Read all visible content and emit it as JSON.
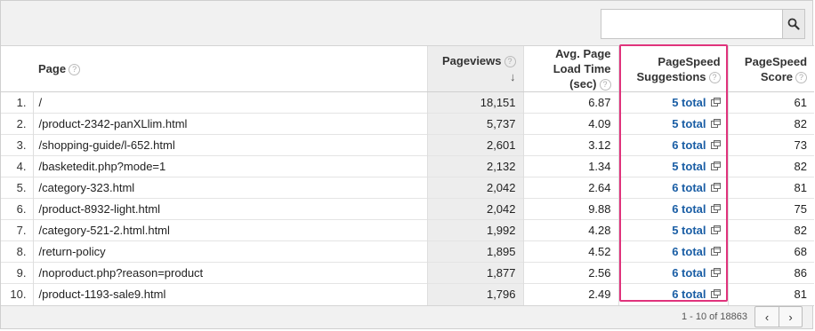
{
  "search": {
    "value": "",
    "placeholder": ""
  },
  "columns": {
    "page": "Page",
    "pageviews": "Pageviews",
    "load_time": "Avg. Page Load Time (sec)",
    "suggestions": "PageSpeed Suggestions",
    "score": "PageSpeed Score"
  },
  "rows": [
    {
      "idx": "1.",
      "page": "/",
      "pageviews": "18,151",
      "load": "6.87",
      "suggestions": "5 total",
      "score": "61"
    },
    {
      "idx": "2.",
      "page": "/product-2342-panXLlim.html",
      "pageviews": "5,737",
      "load": "4.09",
      "suggestions": "5 total",
      "score": "82"
    },
    {
      "idx": "3.",
      "page": "/shopping-guide/l-652.html",
      "pageviews": "2,601",
      "load": "3.12",
      "suggestions": "6 total",
      "score": "73"
    },
    {
      "idx": "4.",
      "page": "/basketedit.php?mode=1",
      "pageviews": "2,132",
      "load": "1.34",
      "suggestions": "5 total",
      "score": "82"
    },
    {
      "idx": "5.",
      "page": "/category-323.html",
      "pageviews": "2,042",
      "load": "2.64",
      "suggestions": "6 total",
      "score": "81"
    },
    {
      "idx": "6.",
      "page": "/product-8932-light.html",
      "pageviews": "2,042",
      "load": "9.88",
      "suggestions": "6 total",
      "score": "75"
    },
    {
      "idx": "7.",
      "page": "/category-521-2.html.html",
      "pageviews": "1,992",
      "load": "4.28",
      "suggestions": "5 total",
      "score": "82"
    },
    {
      "idx": "8.",
      "page": "/return-policy",
      "pageviews": "1,895",
      "load": "4.52",
      "suggestions": "6 total",
      "score": "68"
    },
    {
      "idx": "9.",
      "page": "/noproduct.php?reason=product",
      "pageviews": "1,877",
      "load": "2.56",
      "suggestions": "6 total",
      "score": "86"
    },
    {
      "idx": "10.",
      "page": "/product-1193-sale9.html",
      "pageviews": "1,796",
      "load": "2.49",
      "suggestions": "6 total",
      "score": "81"
    }
  ],
  "pagination": {
    "text": "1 - 10 of 18863",
    "prev": "‹",
    "next": "›"
  },
  "icons": {
    "search": "search-icon",
    "help": "help-icon",
    "sort": "sort-down-arrow-icon",
    "external": "external-link-icon"
  },
  "colors": {
    "link": "#1a5ea5",
    "highlight": "#e0337c",
    "sorted_column": "#ededed"
  }
}
